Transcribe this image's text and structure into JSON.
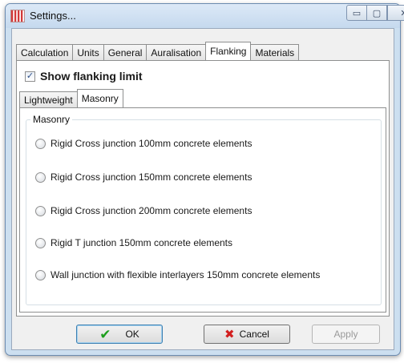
{
  "window": {
    "title": "Settings...",
    "controls": {
      "minimize": "▭",
      "maximize": "▢",
      "close": "✕"
    }
  },
  "main_tabs": [
    {
      "label": "Calculation"
    },
    {
      "label": "Units"
    },
    {
      "label": "General"
    },
    {
      "label": "Auralisation"
    },
    {
      "label": "Flanking",
      "active": true
    },
    {
      "label": "Materials"
    }
  ],
  "flanking": {
    "show_limit_label": "Show flanking limit",
    "show_limit_checked": true,
    "check_glyph": "✓",
    "sub_tabs": [
      {
        "label": "Lightweight"
      },
      {
        "label": "Masonry",
        "active": true
      }
    ],
    "group_label": "Masonry",
    "options": [
      {
        "label": "Rigid Cross junction 100mm concrete elements",
        "selected": false
      },
      {
        "label": "Rigid Cross junction 150mm concrete elements",
        "selected": false
      },
      {
        "label": "Rigid Cross junction 200mm concrete elements",
        "selected": false
      },
      {
        "label": "Rigid T junction 150mm concrete elements",
        "selected": false
      },
      {
        "label": "Wall junction with flexible interlayers 150mm concrete elements",
        "selected": false
      }
    ]
  },
  "buttons": {
    "ok_label": "OK",
    "ok_icon": "✔",
    "cancel_label": "Cancel",
    "cancel_icon": "✖",
    "apply_label": "Apply"
  }
}
